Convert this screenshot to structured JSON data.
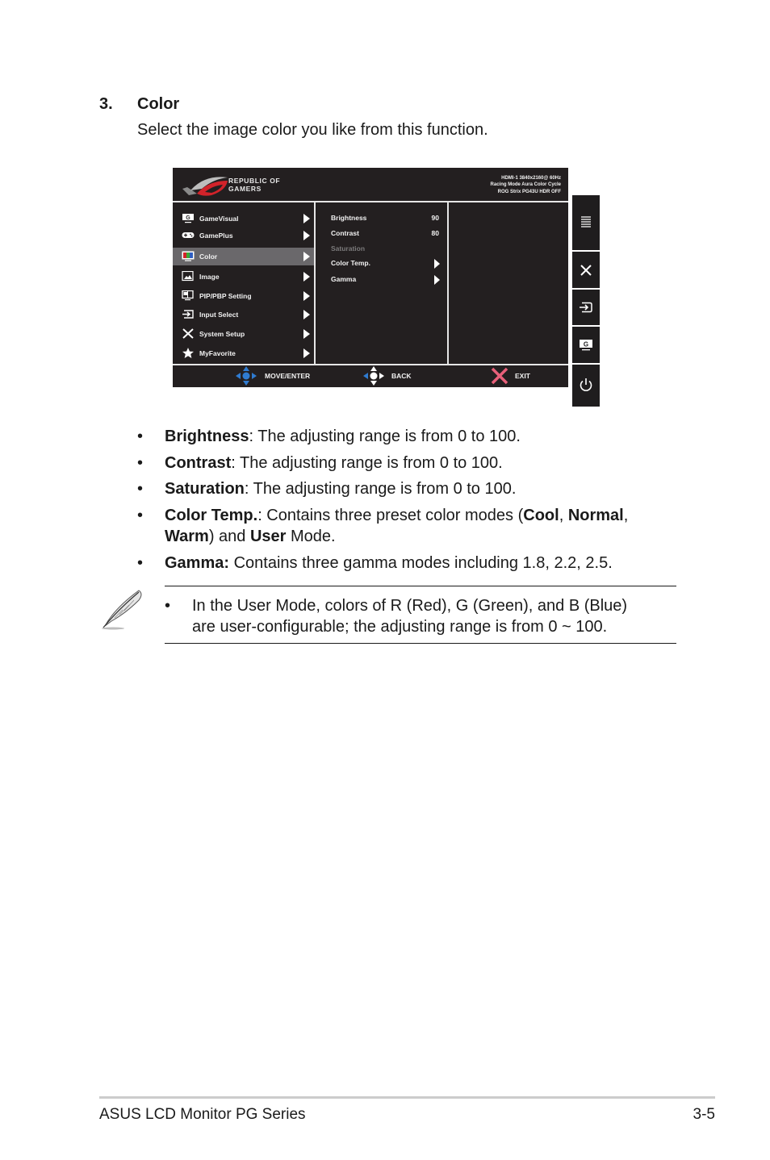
{
  "section": {
    "number": "3.",
    "title": "Color",
    "description": "Select the image color you like from this function."
  },
  "osd": {
    "brand_line1": "REPUBLIC OF",
    "brand_line2": "GAMERS",
    "status_lines": [
      "HDMI-1 3840x2160@ 60Hz",
      "Racing Mode Aura Color Cycle",
      "ROG Strix PG43U HDR OFF"
    ],
    "menu": [
      {
        "label": "GameVisual",
        "icon": "gamevisual-icon",
        "selected": false
      },
      {
        "label": "GamePlus",
        "icon": "gameplus-icon",
        "selected": false
      },
      {
        "label": "Color",
        "icon": "color-icon",
        "selected": true
      },
      {
        "label": "Image",
        "icon": "image-icon",
        "selected": false
      },
      {
        "label": "PIP/PBP Setting",
        "icon": "pip-pbp-icon",
        "selected": false
      },
      {
        "label": "Input Select",
        "icon": "input-select-icon",
        "selected": false
      },
      {
        "label": "System Setup",
        "icon": "system-setup-icon",
        "selected": false
      },
      {
        "label": "MyFavorite",
        "icon": "star-icon",
        "selected": false
      }
    ],
    "submenu": [
      {
        "label": "Brightness",
        "value": "90",
        "enabled": true
      },
      {
        "label": "Contrast",
        "value": "80",
        "enabled": true
      },
      {
        "label": "Saturation",
        "value": "",
        "enabled": false
      },
      {
        "label": "Color Temp.",
        "value": "",
        "enabled": true,
        "has_submenu": true
      },
      {
        "label": "Gamma",
        "value": "",
        "enabled": true,
        "has_submenu": true
      }
    ],
    "footer": {
      "move_enter": "MOVE/ENTER",
      "back": "BACK",
      "exit": "EXIT"
    },
    "colors": {
      "background": "#231f20",
      "selected_row": "#6a686b",
      "divider": "#e6e6e6",
      "nav_blue": "#2f7bd0",
      "exit_pink": "#e8607a",
      "logo_red": "#d2232a"
    }
  },
  "side_buttons": [
    {
      "name": "menu-button",
      "icon": "menu-icon"
    },
    {
      "name": "close-button",
      "icon": "close-icon"
    },
    {
      "name": "input-button",
      "icon": "input-select-icon"
    },
    {
      "name": "gamevisual-button",
      "icon": "gamevisual-icon"
    },
    {
      "name": "power-button",
      "icon": "power-icon"
    }
  ],
  "bullets": [
    {
      "term": "Brightness",
      "sep": ":",
      "text": " The adjusting range is from 0 to 100."
    },
    {
      "term": "Contrast",
      "sep": ":",
      "text": " The adjusting range is from 0 to 100."
    },
    {
      "term": "Saturation",
      "sep": ":",
      "text": " The adjusting range is from 0 to 100."
    },
    {
      "term": "Color Temp.",
      "sep": ":",
      "text": " Contains three preset color modes (",
      "modes": [
        "Cool",
        "Normal",
        "Warm"
      ],
      "user": "User",
      "tail": " Mode."
    },
    {
      "term": "Gamma:",
      "sep": "",
      "text": " Contains three gamma modes including 1.8, 2.2, 2.5."
    }
  ],
  "bullet_char": "•",
  "note": {
    "icon": "feather-pen-icon",
    "text_line1": "In the User Mode, colors of R (Red), G (Green), and B (Blue)",
    "text_line2": "are user-configurable; the adjusting range is from 0 ~ 100."
  },
  "footer": {
    "left": "ASUS LCD Monitor PG Series",
    "right": "3-5"
  }
}
